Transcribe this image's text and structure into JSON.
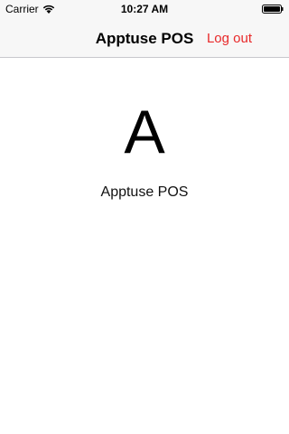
{
  "status_bar": {
    "carrier": "Carrier",
    "time": "10:27 AM",
    "wifi_icon": "wifi-icon",
    "battery_icon": "battery-icon"
  },
  "nav": {
    "title": "Apptuse POS",
    "logout_label": "Log out",
    "logout_color": "#e8292a"
  },
  "main": {
    "logo_letter": "A",
    "app_name": "Apptuse POS"
  }
}
